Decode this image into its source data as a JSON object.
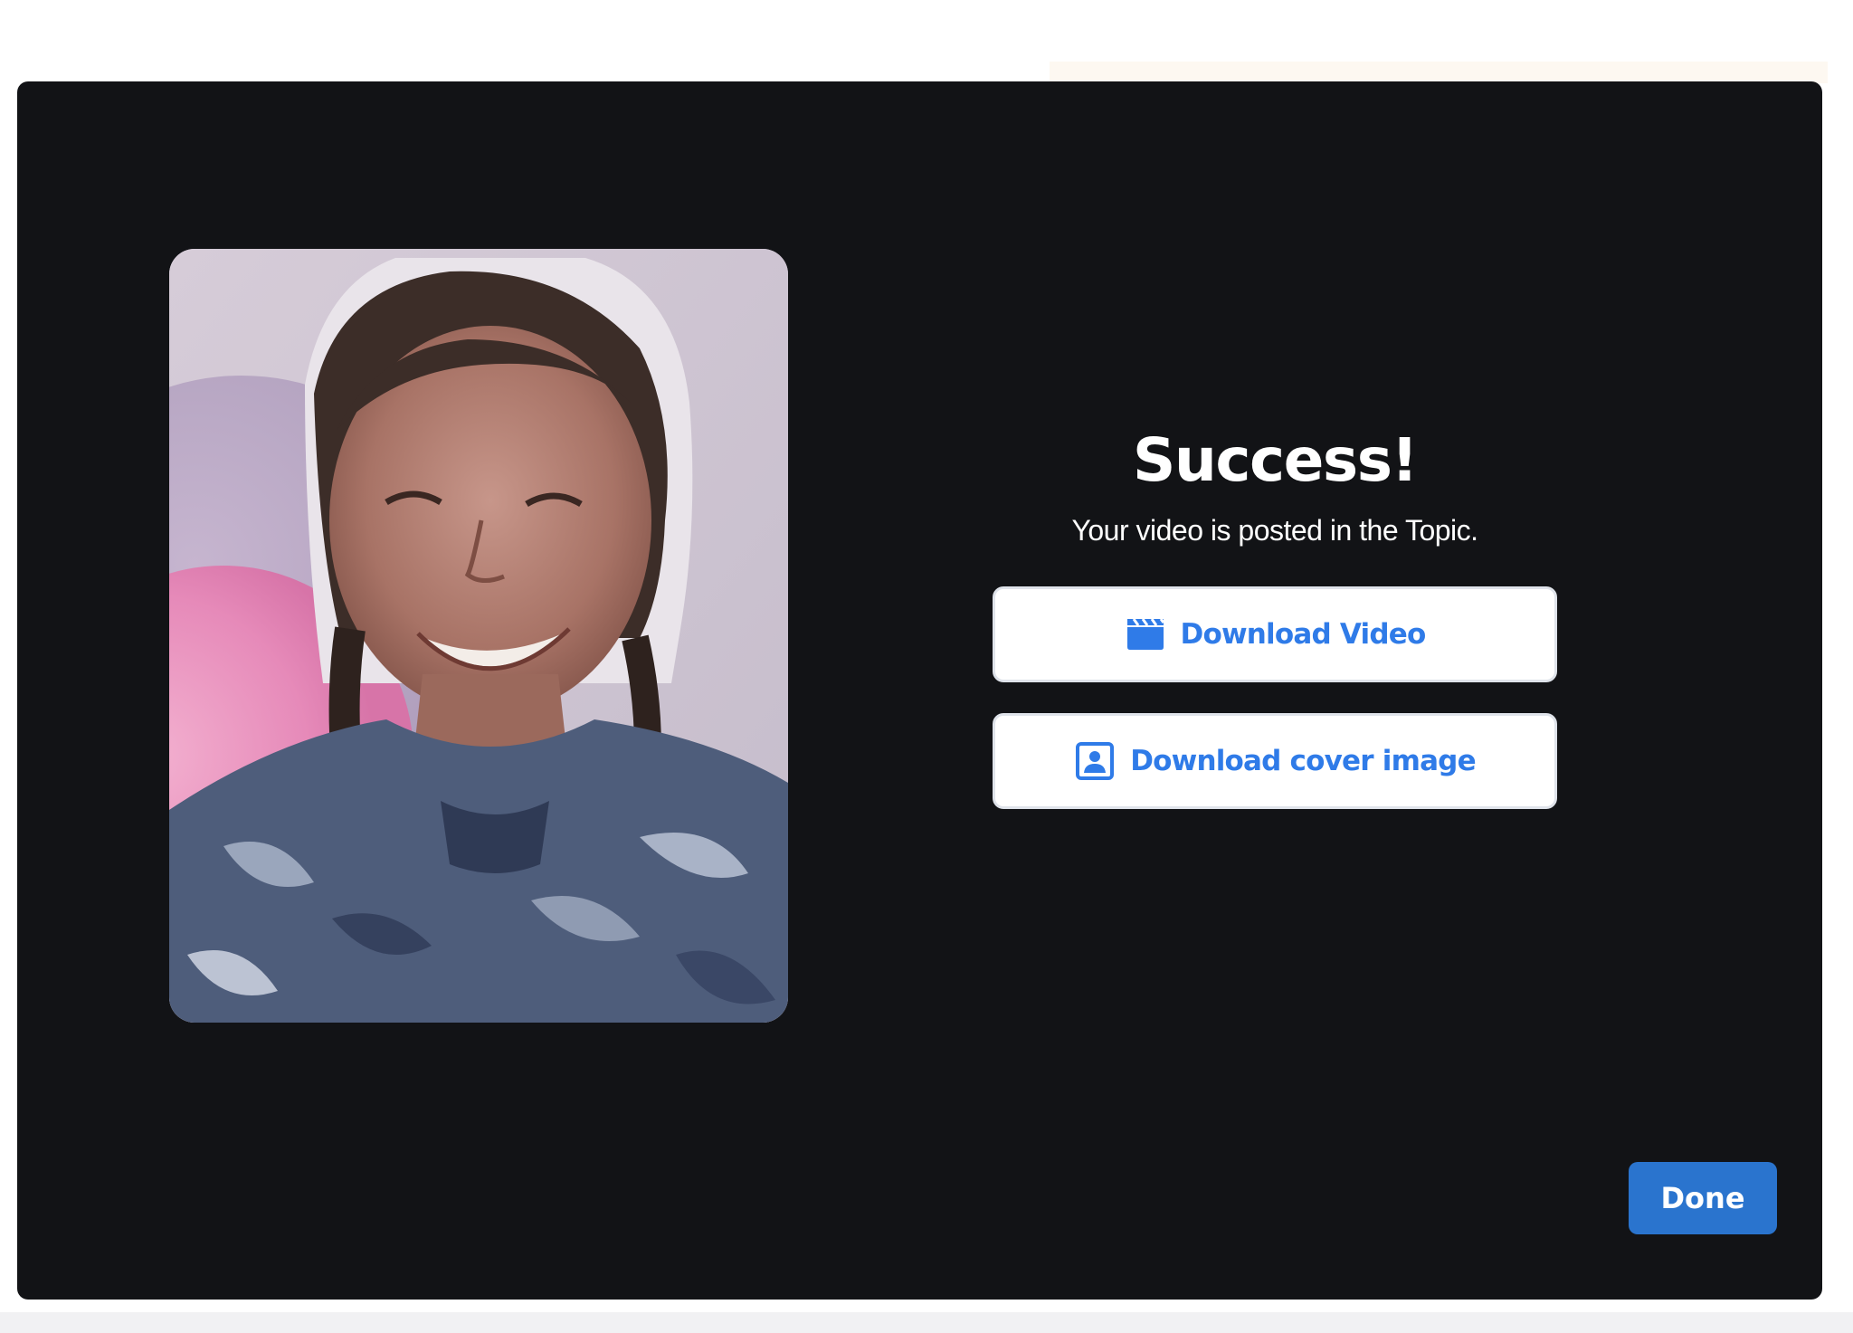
{
  "dialog": {
    "title": "Success!",
    "subtitle": "Your video is posted in the Topic.",
    "buttons": {
      "download_video": {
        "label": "Download Video",
        "icon": "clapperboard-icon"
      },
      "download_cover": {
        "label": "Download cover image",
        "icon": "portrait-image-icon"
      },
      "done": {
        "label": "Done"
      }
    }
  },
  "colors": {
    "modal_background": "#121316",
    "button_text_blue": "#2f7be8",
    "done_button": "#2a74ce",
    "text_white": "#ffffff"
  }
}
